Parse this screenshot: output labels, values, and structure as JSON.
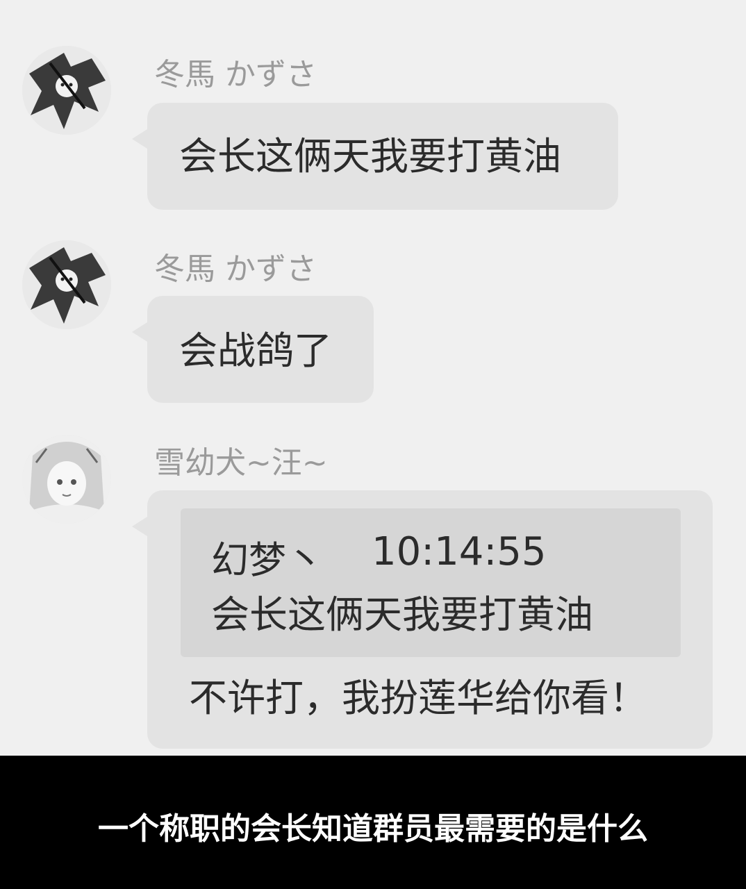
{
  "messages": [
    {
      "sender": "冬馬 かずさ",
      "avatar_icon": "anime-character-avatar-icon",
      "text": "会长这俩天我要打黄油"
    },
    {
      "sender": "冬馬 かずさ",
      "avatar_icon": "anime-character-avatar-icon",
      "text": "会战鸽了"
    },
    {
      "sender": "雪幼犬~汪~",
      "avatar_icon": "anime-girl-avatar-icon",
      "quote": {
        "author": "幻梦丶",
        "time": "10:14:55",
        "text": "会长这俩天我要打黄油"
      },
      "text": "不许打，我扮莲华给你看！"
    }
  ],
  "caption": "一个称职的会长知道群员最需要的是什么",
  "colors": {
    "background": "#f0f0f0",
    "bubble": "#e3e3e3",
    "quote": "#d6d6d6",
    "name": "#9a9a9a",
    "caption_bar": "#000000"
  }
}
